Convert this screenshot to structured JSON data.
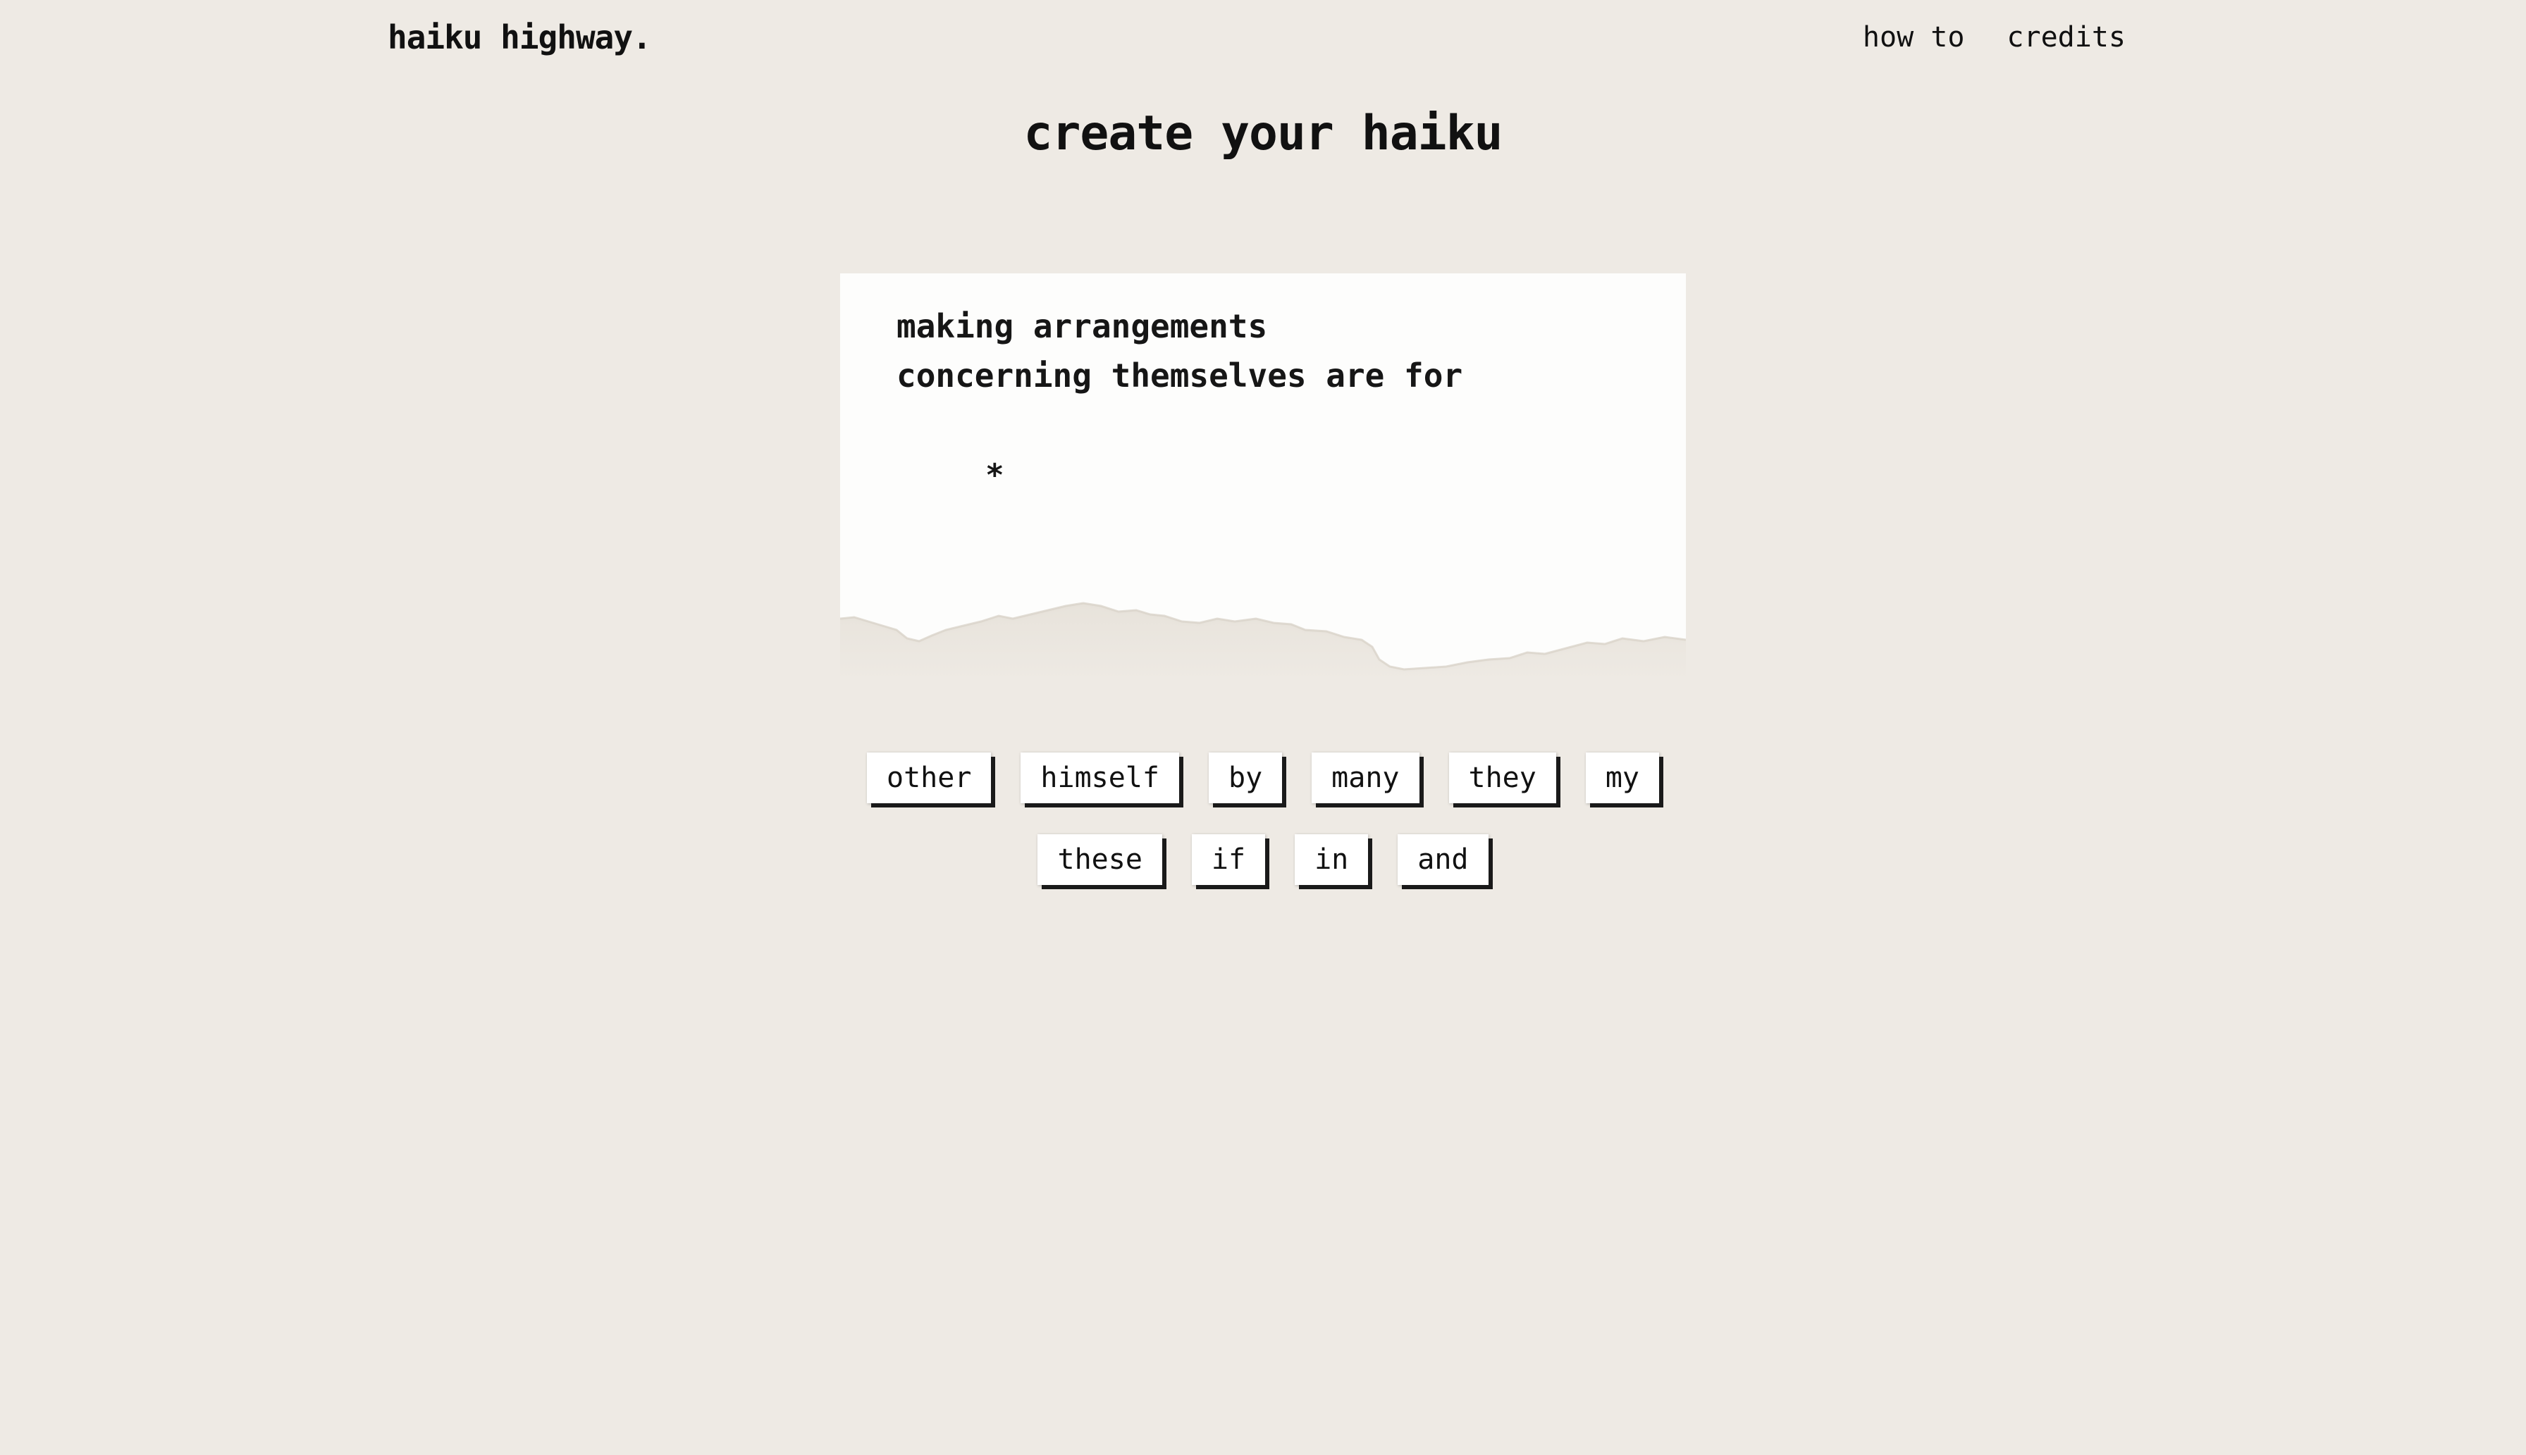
{
  "header": {
    "brand": "haiku highway.",
    "nav": [
      {
        "label": "how to"
      },
      {
        "label": "credits"
      }
    ]
  },
  "page": {
    "title": "create your haiku"
  },
  "haiku": {
    "lines": [
      "making arrangements",
      "concerning themselves are for"
    ],
    "cursor_symbol": "*"
  },
  "word_tiles": {
    "row1": [
      "other",
      "himself",
      "by",
      "many",
      "they",
      "my"
    ],
    "row2": [
      "these",
      "if",
      "in",
      "and"
    ]
  },
  "colors": {
    "background": "#eeeae4",
    "paper": "#fdfdfc",
    "tile": "#ffffff",
    "tile_shadow": "#1a1a1a",
    "text": "#111111"
  }
}
